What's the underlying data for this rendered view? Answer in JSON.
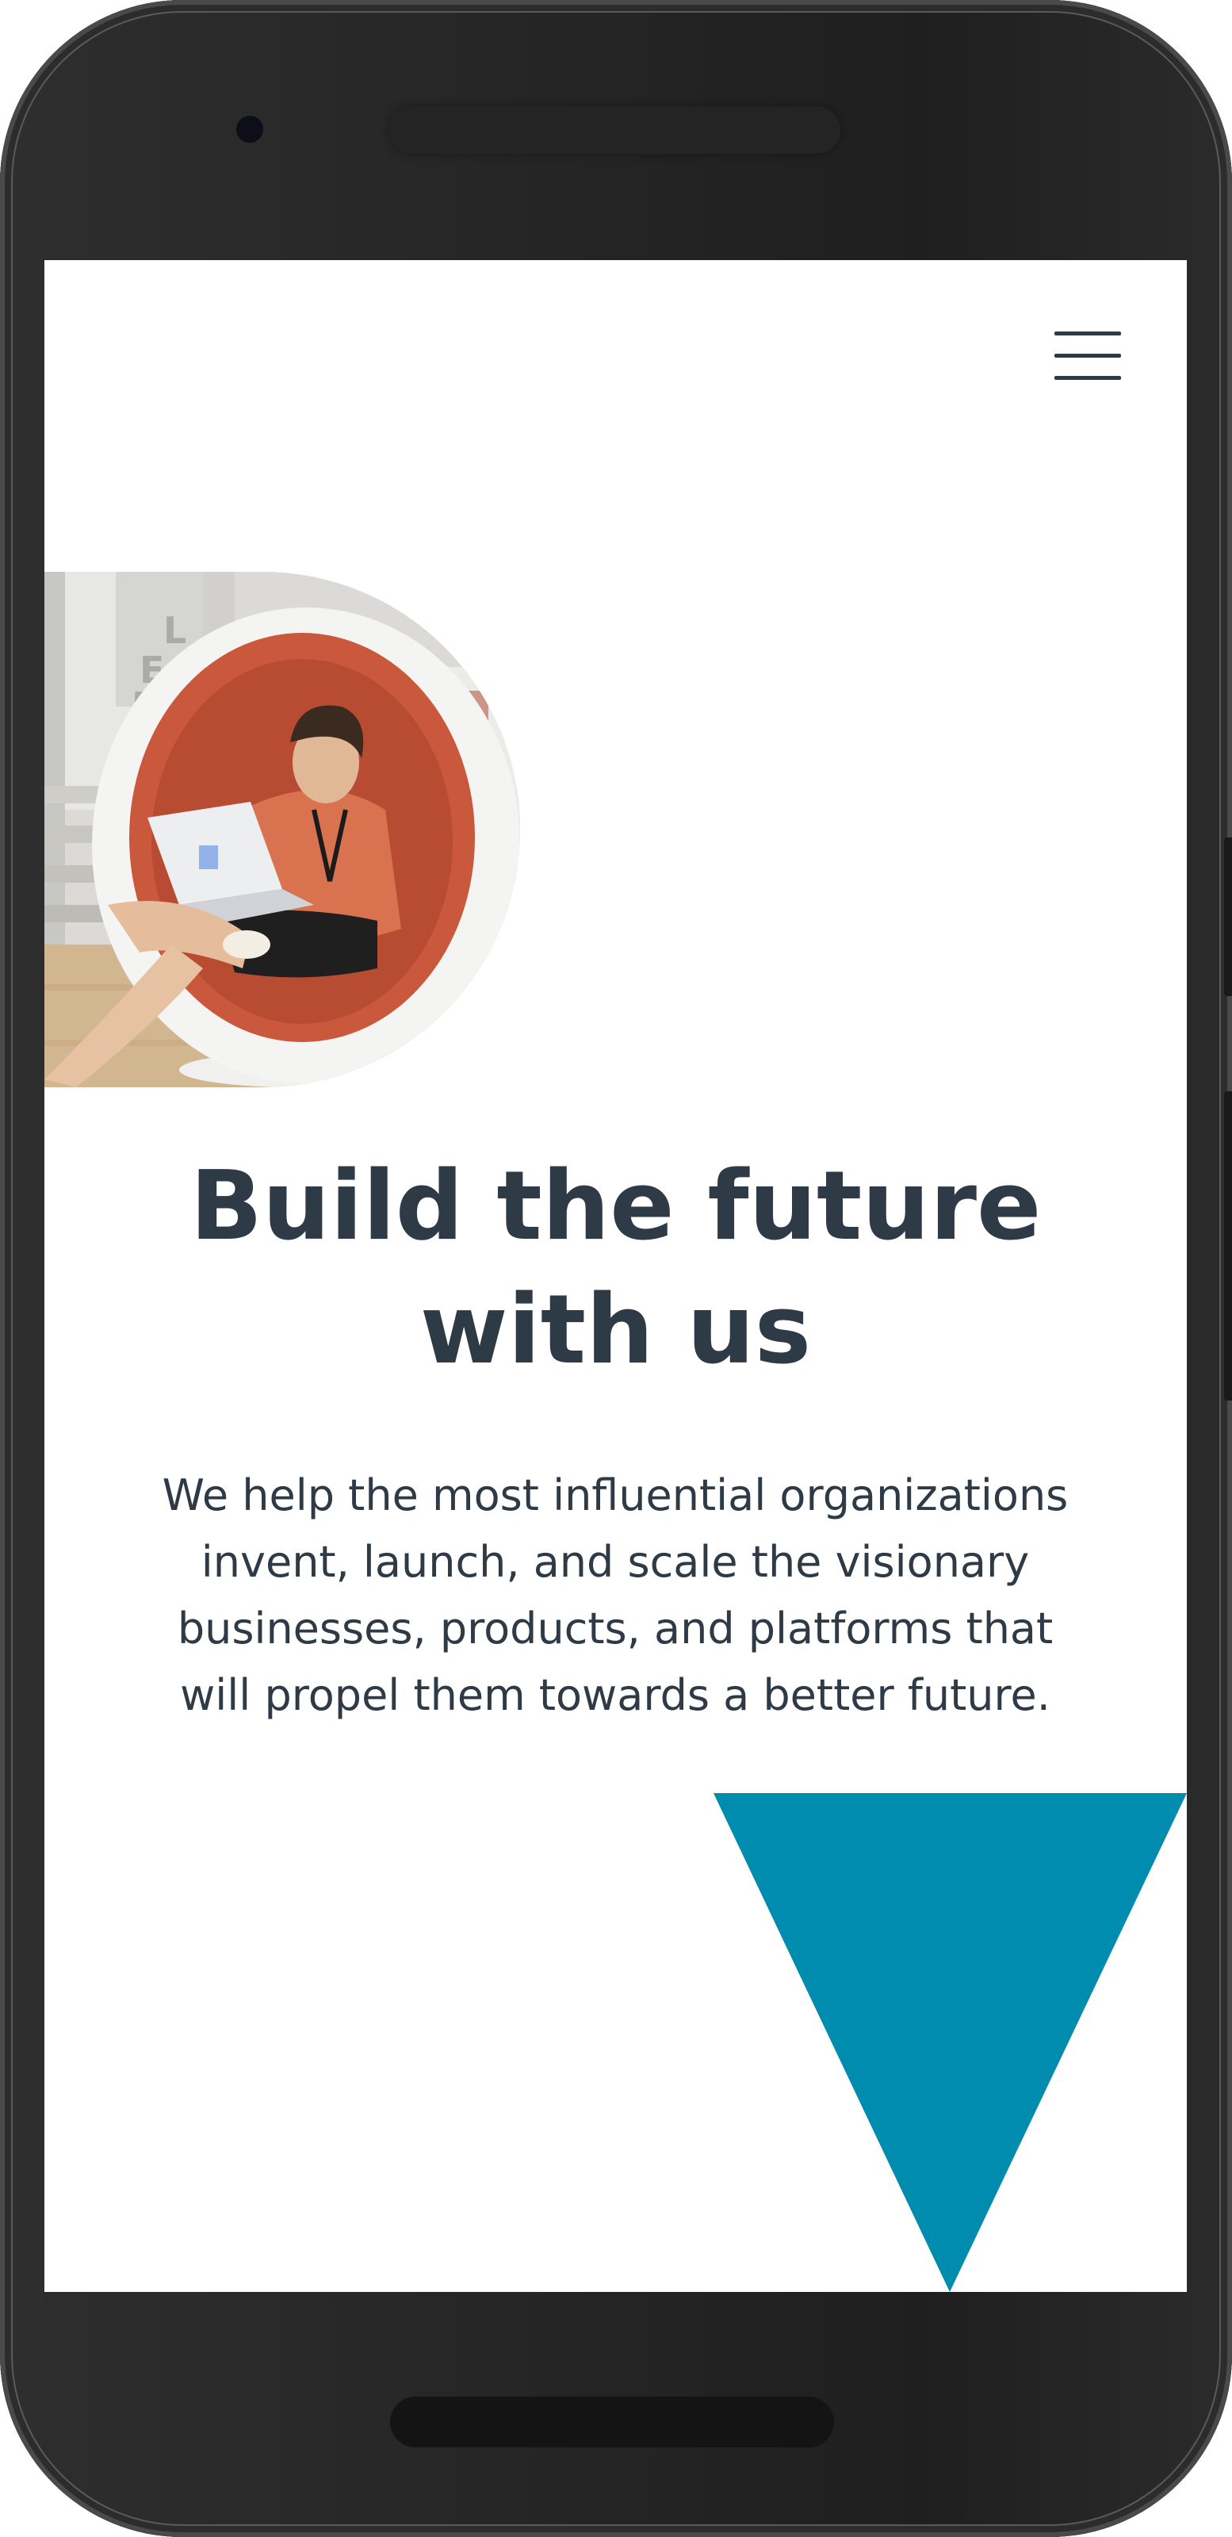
{
  "header": {
    "menu_icon": "hamburger-menu-icon"
  },
  "hero": {
    "image_icon": "hero-photo",
    "headline_lines": [
      "Build the future",
      "with us"
    ],
    "subtext_lines": [
      "We help the most influential organizations",
      "invent, launch, and scale the visionary",
      "businesses, products, and platforms that",
      "will propel them towards a better future."
    ]
  },
  "colors": {
    "text": "#2e3a46",
    "accent": "#008cae",
    "background": "#ffffff",
    "chair_shell": "#f4f4f2",
    "chair_interior": "#c9583c",
    "shirt": "#d9734f"
  }
}
